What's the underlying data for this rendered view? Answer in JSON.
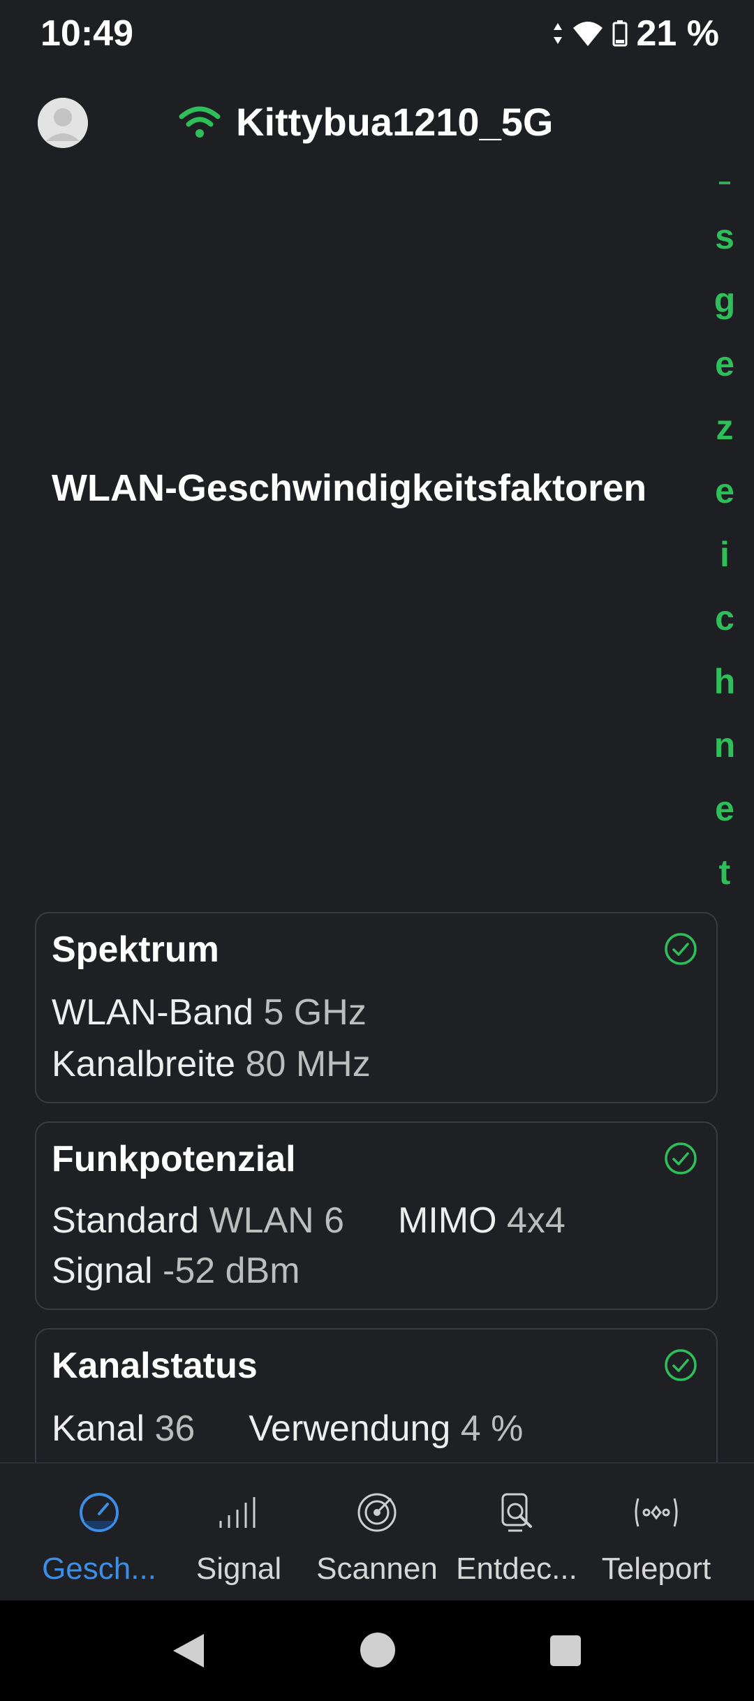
{
  "status_bar": {
    "time": "10:49",
    "battery": "21 %"
  },
  "header": {
    "ssid": "Kittybua1210_5G"
  },
  "hero": {
    "title": "WLAN-Geschwindigkeitsfaktoren",
    "vertical_text": [
      "s",
      "g",
      "e",
      "z",
      "e",
      "i",
      "c",
      "h",
      "n",
      "e",
      "t"
    ]
  },
  "cards": [
    {
      "title": "Spektrum",
      "lines": [
        [
          {
            "label": "WLAN-Band",
            "value": "5 GHz"
          }
        ],
        [
          {
            "label": "Kanalbreite",
            "value": "80 MHz"
          }
        ]
      ]
    },
    {
      "title": "Funkpotenzial",
      "lines": [
        [
          {
            "label": "Standard",
            "value": "WLAN 6"
          },
          {
            "label": "MIMO",
            "value": "4x4"
          }
        ],
        [
          {
            "label": "Signal",
            "value": "-52 dBm"
          }
        ]
      ]
    },
    {
      "title": "Kanalstatus",
      "lines": [
        [
          {
            "label": "Kanal",
            "value": "36"
          },
          {
            "label": "Verwendung",
            "value": "4 %"
          }
        ]
      ]
    }
  ],
  "bottom_nav": [
    {
      "label": "Gesch...",
      "icon": "speedometer-icon",
      "active": true
    },
    {
      "label": "Signal",
      "icon": "signal-bars-icon",
      "active": false
    },
    {
      "label": "Scannen",
      "icon": "radar-icon",
      "active": false
    },
    {
      "label": "Entdec...",
      "icon": "device-search-icon",
      "active": false
    },
    {
      "label": "Teleport",
      "icon": "teleport-icon",
      "active": false
    }
  ],
  "colors": {
    "background": "#1e1f23",
    "accent_green": "#2fbf5a",
    "active_blue": "#3d8ee6"
  }
}
